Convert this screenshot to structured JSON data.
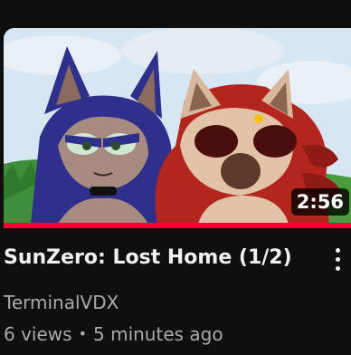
{
  "video": {
    "duration": "2:56",
    "title": "SunZero: Lost Home (1/2)",
    "channel": "TerminalVDX",
    "views": "6 views",
    "separator": "•",
    "uploaded": "5 minutes ago",
    "watch_progress": 1.0
  },
  "colors": {
    "background": "#0f0f0f",
    "progress": "#ff0033",
    "title": "#f1f1f1",
    "secondary_text": "#aaaaaa"
  },
  "icons": {
    "menu": "more-vert-icon"
  }
}
